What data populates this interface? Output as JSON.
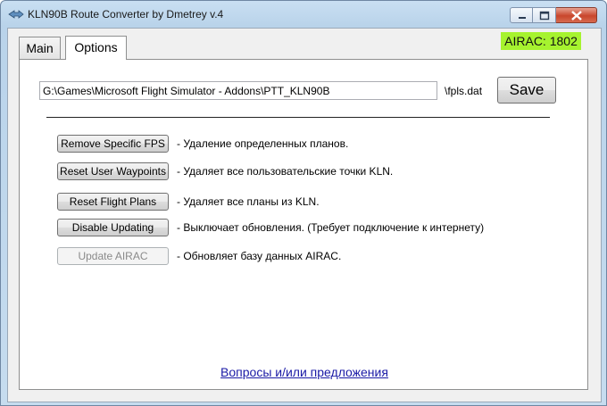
{
  "window": {
    "title": "KLN90B Route Converter by Dmetrey  v.4",
    "controls": {
      "minimize": "minimize",
      "maximize": "maximize",
      "close": "close"
    }
  },
  "tabs": [
    {
      "label": "Main",
      "active": false
    },
    {
      "label": "Options",
      "active": true
    }
  ],
  "airac_badge": "AIRAC: 1802",
  "path": {
    "value": "G:\\Games\\Microsoft Flight Simulator - Addons\\PTT_KLN90B",
    "suffix": "\\fpls.dat",
    "save_label": "Save"
  },
  "actions": [
    {
      "label": "Remove Specific FPS",
      "description": "- Удаление определенных планов.",
      "enabled": true
    },
    {
      "label": "Reset User Waypoints",
      "description": "- Удаляет все пользовательские точки KLN.",
      "enabled": true
    },
    {
      "label": "Reset Flight Plans",
      "description": "- Удаляет все планы из KLN.",
      "enabled": true
    },
    {
      "label": "Disable Updating",
      "description": "- Выключает обновления. (Требует подключение к интернету)",
      "enabled": true
    },
    {
      "label": "Update AIRAC",
      "description": "- Обновляет базу данных AIRAC.",
      "enabled": false
    }
  ],
  "feedback_link": "Вопросы и/или предложения",
  "colors": {
    "airac_badge": "#a6f32f",
    "link": "#1a1aa6"
  }
}
